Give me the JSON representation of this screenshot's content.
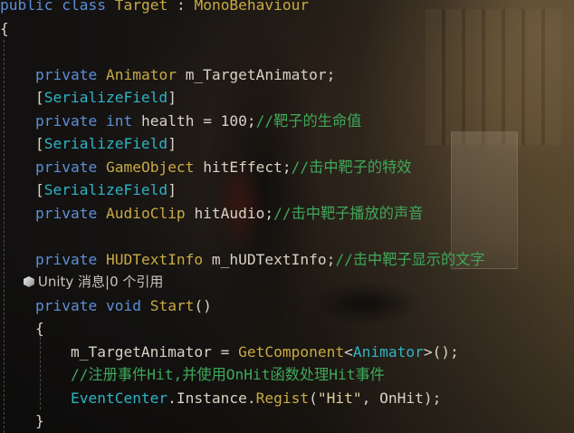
{
  "code": {
    "line1": {
      "kw_public": "public",
      "kw_class": "class",
      "class_name": "Target",
      "colon": " : ",
      "base": "MonoBehaviour"
    },
    "line2": {
      "brace": "{"
    },
    "line4": {
      "kw_private": "private",
      "type": "Animator",
      "name": "m_TargetAnimator;"
    },
    "line5": {
      "open": "[",
      "attr": "SerializeField",
      "close": "]"
    },
    "line6": {
      "kw_private": "private",
      "kw_int": "int",
      "rest": "health = 100;",
      "comment": "//靶子的生命值"
    },
    "line7": {
      "open": "[",
      "attr": "SerializeField",
      "close": "]"
    },
    "line8": {
      "kw_private": "private",
      "type": "GameObject",
      "name": "hitEffect;",
      "comment": "//击中靶子的特效"
    },
    "line9": {
      "open": "[",
      "attr": "SerializeField",
      "close": "]"
    },
    "line10": {
      "kw_private": "private",
      "type": "AudioClip",
      "name": "hitAudio;",
      "comment": "//击中靶子播放的声音"
    },
    "line12": {
      "kw_private": "private",
      "type": "HUDTextInfo",
      "name": "m_hUDTextInfo;",
      "comment": "//击中靶子显示的文字"
    },
    "codelens": {
      "text": "Unity 消息|0 个引用"
    },
    "line13": {
      "kw_private": "private",
      "kw_void": "void",
      "method": "Start",
      "parens": "()"
    },
    "line14": {
      "brace": "{"
    },
    "line15": {
      "var": "m_TargetAnimator = ",
      "method": "GetComponent",
      "lt": "<",
      "type": "Animator",
      "gt": ">",
      "end": "();"
    },
    "line16": {
      "comment": "//注册事件Hit,并使用OnHit函数处理Hit事件"
    },
    "line17": {
      "type": "EventCenter",
      "dot1": ".",
      "inst": "Instance",
      "dot2": ".",
      "method": "Regist",
      "open": "(",
      "str": "\"Hit\"",
      "rest": ", OnHit);"
    },
    "line18": {
      "brace": "}"
    }
  },
  "colors": {
    "keyword": "#5c8fd6",
    "type": "#c9aa43",
    "attribute": "#2fb3c4",
    "identifier": "#d8d2c4",
    "comment": "#3fa85a",
    "string": "#e0cfa0"
  },
  "icons": {
    "codelens_icon": "unity-cube-icon"
  }
}
